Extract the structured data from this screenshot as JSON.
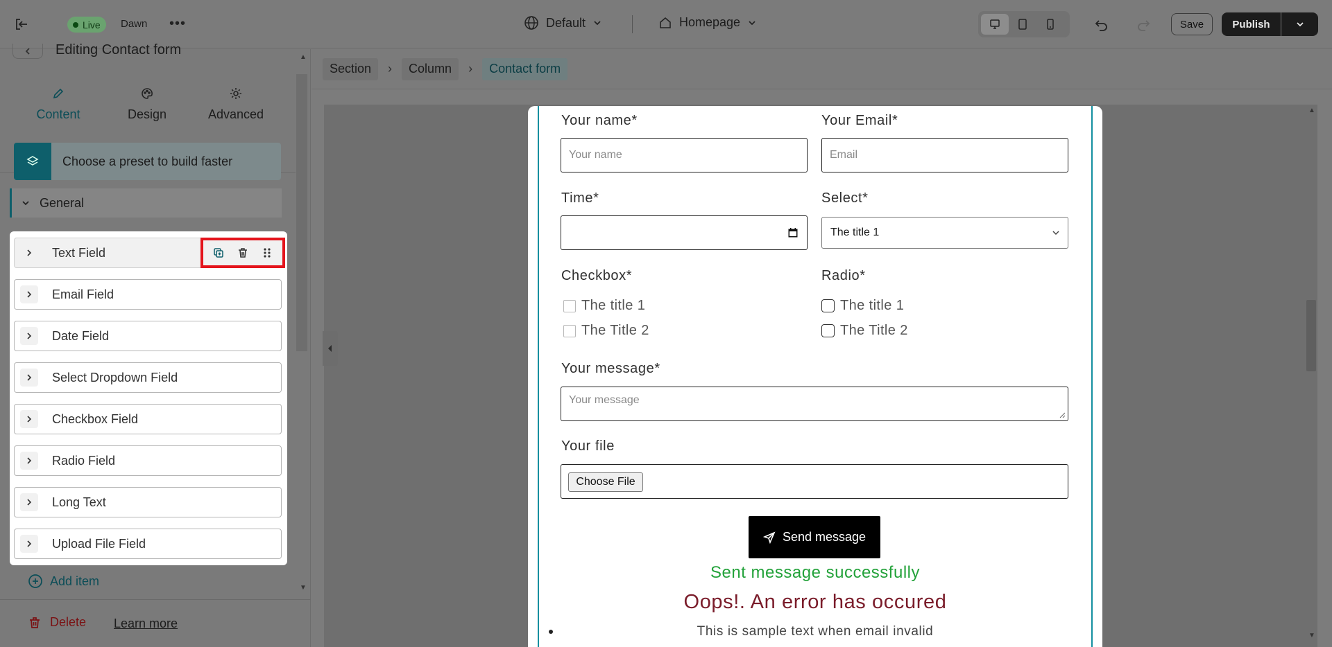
{
  "topbar": {
    "live_label": "Live",
    "theme_name": "Dawn",
    "more_label": "•••",
    "locale": "Default",
    "page": "Homepage",
    "save_label": "Save",
    "publish_label": "Publish"
  },
  "sidebar": {
    "title": "Editing Contact form",
    "tabs": [
      {
        "label": "Content",
        "icon": "pencil-icon",
        "active": true
      },
      {
        "label": "Design",
        "icon": "palette-icon",
        "active": false
      },
      {
        "label": "Advanced",
        "icon": "gear-icon",
        "active": false
      }
    ],
    "preset_label": "Choose a preset to build faster",
    "group_label": "General",
    "items": [
      {
        "label": "Text Field"
      },
      {
        "label": "Email Field"
      },
      {
        "label": "Date Field"
      },
      {
        "label": "Select Dropdown Field"
      },
      {
        "label": "Checkbox Field"
      },
      {
        "label": "Radio Field"
      },
      {
        "label": "Long Text"
      },
      {
        "label": "Upload File Field"
      }
    ],
    "add_item_label": "Add item",
    "delete_label": "Delete",
    "learn_more_label": "Learn more"
  },
  "breadcrumb": {
    "items": [
      "Section",
      "Column",
      "Contact form"
    ]
  },
  "form": {
    "name_label": "Your name*",
    "name_placeholder": "Your name",
    "email_label": "Your Email*",
    "email_placeholder": "Email",
    "time_label": "Time*",
    "select_label": "Select*",
    "select_value": "The title 1",
    "checkbox_label": "Checkbox*",
    "checkbox_options": [
      "The title 1",
      "The Title 2"
    ],
    "radio_label": "Radio*",
    "radio_options": [
      "The title 1",
      "The Title 2"
    ],
    "message_label": "Your message*",
    "message_placeholder": "Your message",
    "file_label": "Your file",
    "file_button": "Choose File",
    "send_label": "Send message",
    "success_text": "Sent message successfully",
    "error_text": "Oops!. An error has occured",
    "sample_text": "This is sample text when email invalid"
  },
  "colors": {
    "accent": "#0e5f6b",
    "selection": "#138fa0",
    "highlight_box": "#e4141c",
    "success": "#23a23a",
    "error": "#7a1c2a"
  }
}
